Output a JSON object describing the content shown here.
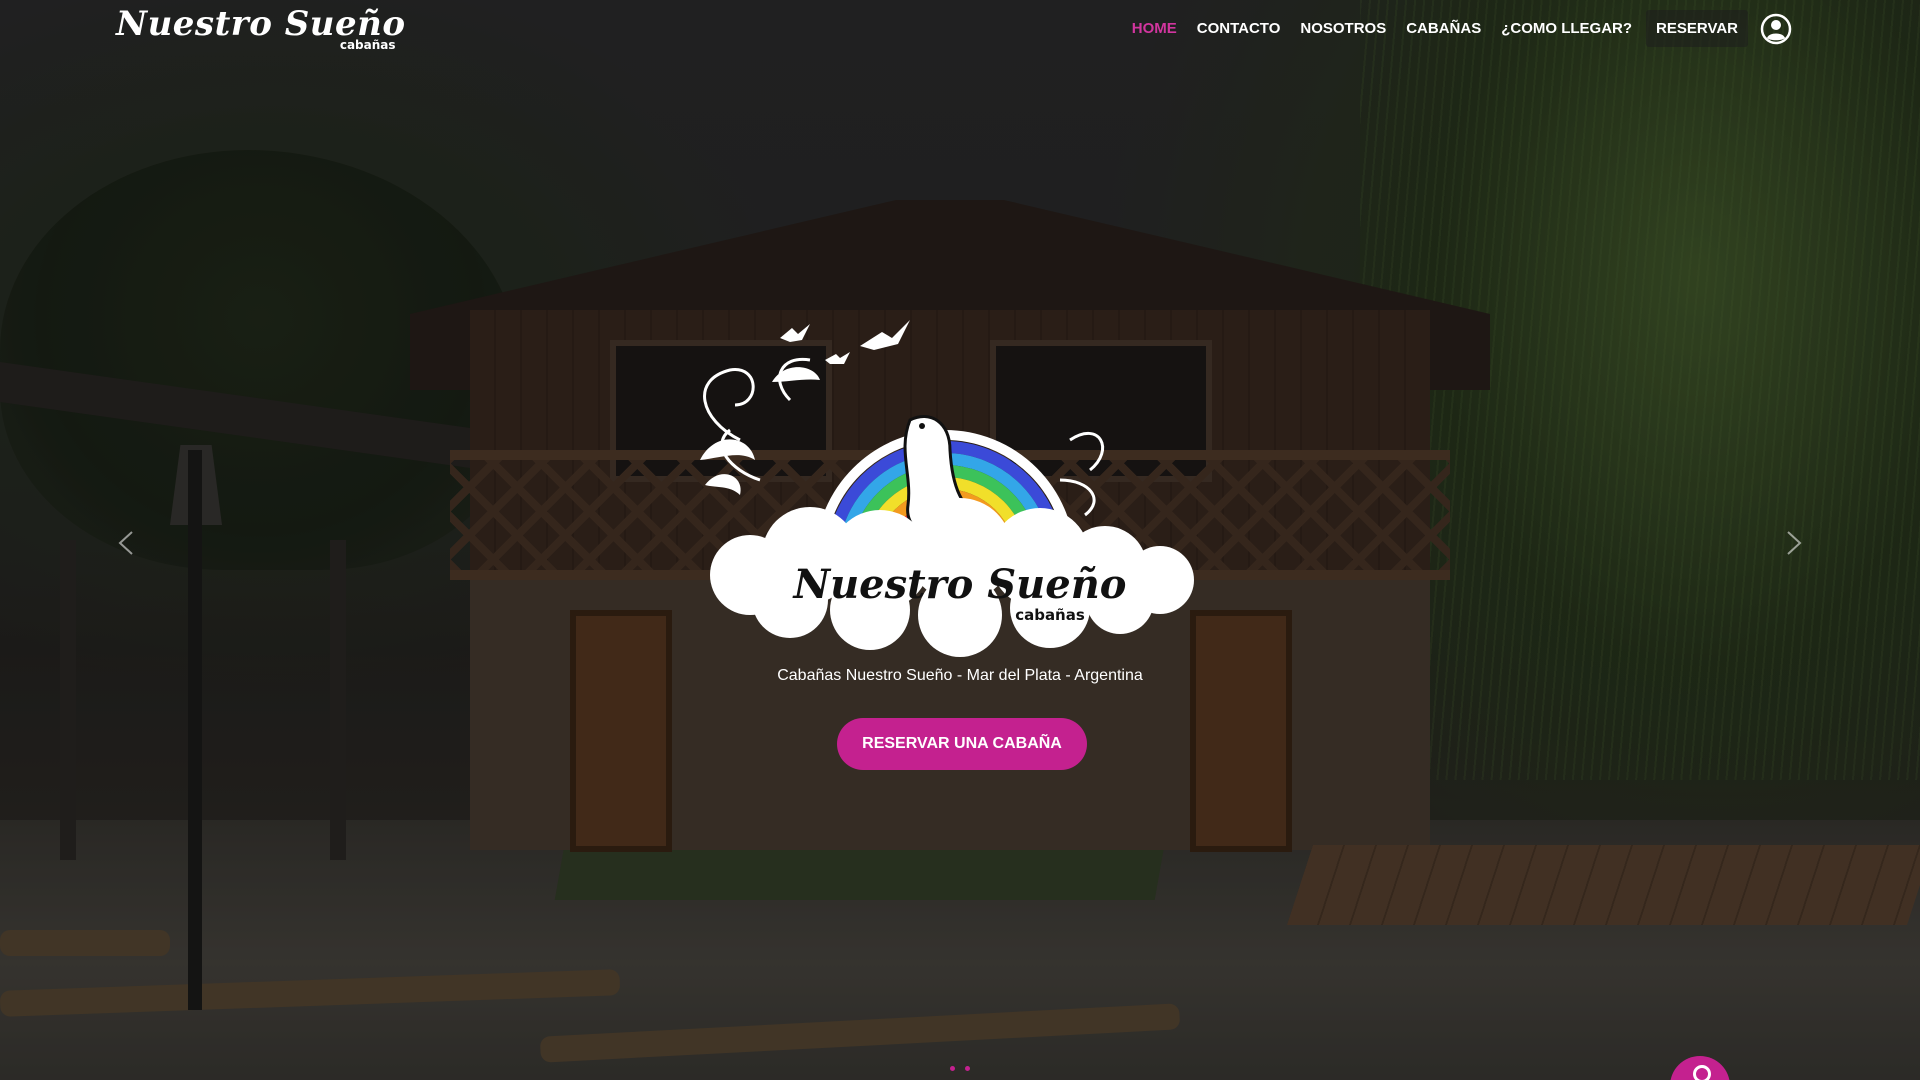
{
  "brand": {
    "name": "Nuestro Sueño",
    "sub": "cabañas"
  },
  "nav": {
    "items": [
      {
        "label": "HOME",
        "active": true
      },
      {
        "label": "CONTACTO",
        "active": false
      },
      {
        "label": "NOSOTROS",
        "active": false
      },
      {
        "label": "CABAÑAS",
        "active": false
      },
      {
        "label": "¿COMO LLEGAR?",
        "active": false
      },
      {
        "label": "RESERVAR",
        "active": false
      }
    ],
    "account_icon": "user-circle-icon"
  },
  "hero": {
    "emblem": {
      "name": "Nuestro Sueño",
      "sub": "cabañas",
      "icons": [
        "bird-icon",
        "sea-lion-icon",
        "rainbow-icon",
        "cloud-icon",
        "flourish-icon"
      ]
    },
    "tagline": "Cabañas Nuestro Sueño - Mar del Plata - Argentina",
    "cta_label": "RESERVAR UNA CABAÑA"
  },
  "slider": {
    "prev_icon": "chevron-left-icon",
    "next_icon": "chevron-right-icon",
    "dot_count": 2
  },
  "fab": {
    "icon": "chat-icon"
  },
  "colors": {
    "accent": "#c4218f",
    "active_nav": "#d2359f",
    "text": "#ffffff"
  }
}
